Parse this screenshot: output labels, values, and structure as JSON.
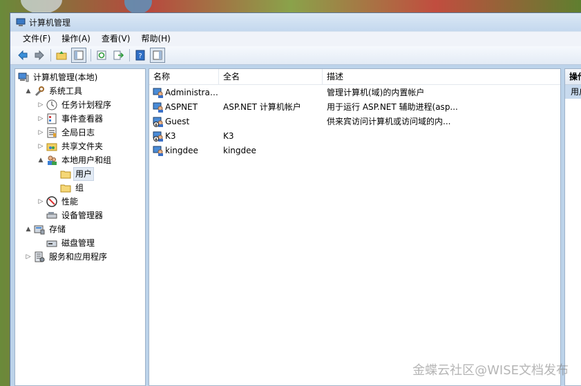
{
  "window": {
    "title": "计算机管理"
  },
  "menu": [
    "文件(F)",
    "操作(A)",
    "查看(V)",
    "帮助(H)"
  ],
  "toolbar": [
    "back-icon",
    "forward-icon",
    "up-folder-icon",
    "show-tree-icon",
    "refresh-icon",
    "export-icon",
    "help-icon",
    "action-pane-icon"
  ],
  "tree": [
    {
      "label": "计算机管理(本地)",
      "icon": "computer-icon",
      "level": 0,
      "arrow": ""
    },
    {
      "label": "系统工具",
      "icon": "tools-icon",
      "level": 1,
      "arrow": "▲"
    },
    {
      "label": "任务计划程序",
      "icon": "clock-icon",
      "level": 2,
      "arrow": "▷"
    },
    {
      "label": "事件查看器",
      "icon": "event-viewer-icon",
      "level": 2,
      "arrow": "▷"
    },
    {
      "label": "全局日志",
      "icon": "log-icon",
      "level": 2,
      "arrow": "▷"
    },
    {
      "label": "共享文件夹",
      "icon": "shared-folder-icon",
      "level": 2,
      "arrow": "▷"
    },
    {
      "label": "本地用户和组",
      "icon": "users-icon",
      "level": 2,
      "arrow": "▲"
    },
    {
      "label": "用户",
      "icon": "folder-icon",
      "level": 3,
      "arrow": ""
    },
    {
      "label": "组",
      "icon": "folder-icon",
      "level": 3,
      "arrow": ""
    },
    {
      "label": "性能",
      "icon": "performance-icon",
      "level": 2,
      "arrow": "▷"
    },
    {
      "label": "设备管理器",
      "icon": "device-icon",
      "level": 2,
      "arrow": ""
    },
    {
      "label": "存储",
      "icon": "storage-icon",
      "level": 1,
      "arrow": "▲"
    },
    {
      "label": "磁盘管理",
      "icon": "disk-icon",
      "level": 2,
      "arrow": ""
    },
    {
      "label": "服务和应用程序",
      "icon": "services-icon",
      "level": 1,
      "arrow": "▷"
    }
  ],
  "list": {
    "columns": [
      "名称",
      "全名",
      "描述"
    ],
    "rows": [
      {
        "name": "Administrat...",
        "full": "",
        "desc": "管理计算机(域)的内置帐户",
        "disabled": false
      },
      {
        "name": "ASPNET",
        "full": "ASP.NET 计算机帐户",
        "desc": "用于运行 ASP.NET 辅助进程(asp...",
        "disabled": false
      },
      {
        "name": "Guest",
        "full": "",
        "desc": "供来宾访问计算机或访问域的内...",
        "disabled": true
      },
      {
        "name": "K3",
        "full": "K3",
        "desc": "",
        "disabled": true
      },
      {
        "name": "kingdee",
        "full": "kingdee",
        "desc": "",
        "disabled": false
      }
    ]
  },
  "actions": {
    "header": "操作",
    "item": "用户"
  },
  "watermark": "金蝶云社区@WISE文档发布"
}
